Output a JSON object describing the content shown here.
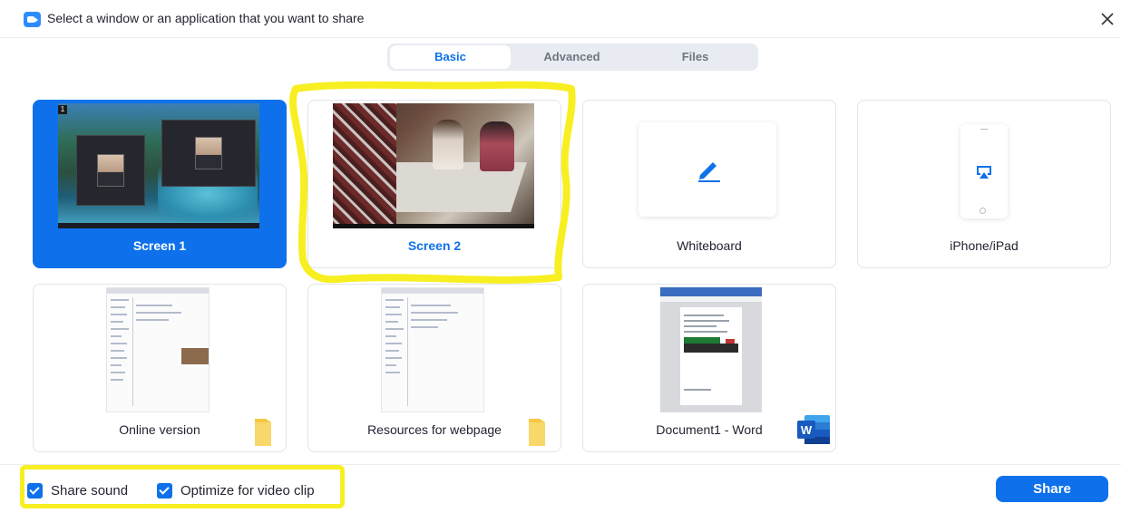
{
  "window": {
    "title": "Select a window or an application that you want to share",
    "logo_icon": "zoom-camera-icon",
    "close_icon": "close-icon"
  },
  "tabs": [
    {
      "label": "Basic",
      "active": true
    },
    {
      "label": "Advanced",
      "active": false
    },
    {
      "label": "Files",
      "active": false
    }
  ],
  "tiles": [
    {
      "label": "Screen 1",
      "selected": true,
      "badge": "1"
    },
    {
      "label": "Screen 2",
      "selected": false
    },
    {
      "label": "Whiteboard",
      "icon": "pen-icon"
    },
    {
      "label": "iPhone/iPad",
      "icon": "airplay-icon"
    },
    {
      "label": "Online version",
      "icon": "folder-icon"
    },
    {
      "label": "Resources for webpage",
      "icon": "folder-icon"
    },
    {
      "label": "Document1 - Word",
      "icon": "word-icon"
    }
  ],
  "footer": {
    "share_sound": {
      "label": "Share sound",
      "checked": true
    },
    "optimize_video": {
      "label": "Optimize for video clip",
      "checked": true
    },
    "share_button": "Share"
  },
  "colors": {
    "accent": "#0e71eb",
    "highlight": "#f7ef21",
    "folder": "#f5c842",
    "word": "#2b579a"
  }
}
